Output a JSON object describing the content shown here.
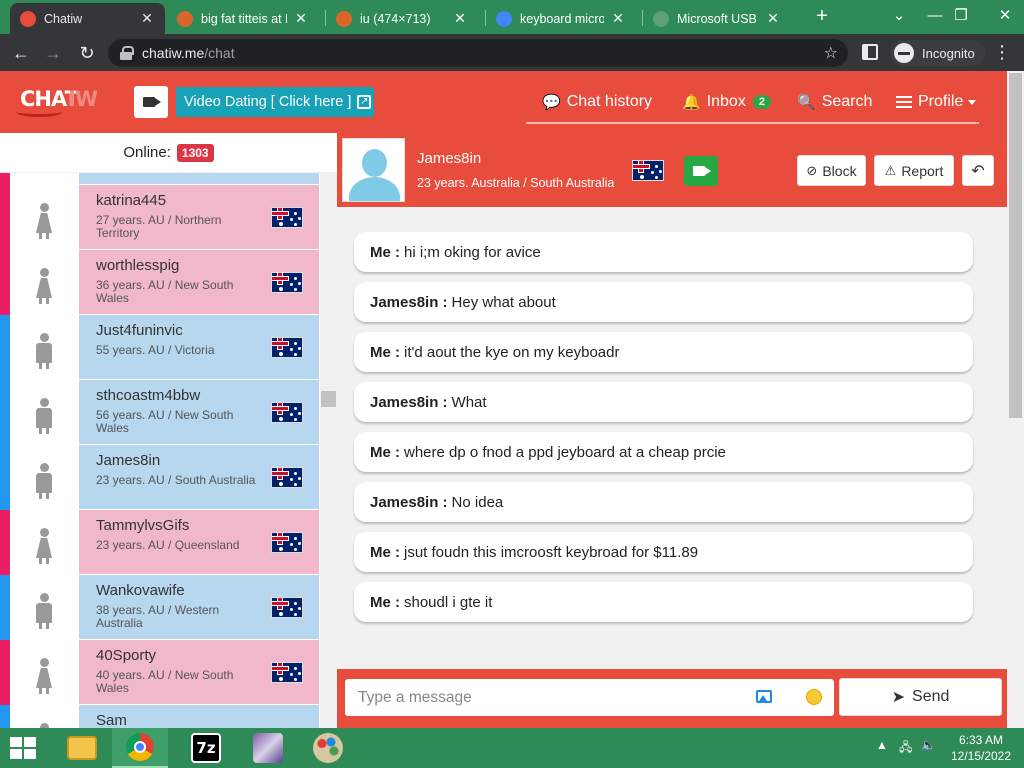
{
  "browser": {
    "tabs": [
      {
        "title": "Chatiw",
        "favicon_color": "#e84c3d",
        "active": true
      },
      {
        "title": "big fat titteis at D",
        "favicon_color": "#d9652b",
        "active": false
      },
      {
        "title": "iu (474×713)",
        "favicon_color": "#d9652b",
        "active": false
      },
      {
        "title": "keyboard microsc",
        "favicon_color": "#4285f4",
        "active": false
      },
      {
        "title": "Microsoft USB W",
        "favicon_color": "#5f9f7a",
        "active": false
      }
    ],
    "url_host": "chatiw.me",
    "url_path": "/chat",
    "profile_label": "Incognito"
  },
  "site": {
    "logo_text_a": "CHAT",
    "logo_text_b": "IW",
    "dating_label": "Video Dating [ Click here ]",
    "nav": {
      "chat_history": "Chat history",
      "inbox": "Inbox",
      "inbox_count": "2",
      "search": "Search",
      "profile": "Profile"
    },
    "accent_color": "#e84c3d"
  },
  "sidebar": {
    "online_label": "Online:",
    "online_count": "1303",
    "users": [
      {
        "name": "katrina445",
        "meta": "27 years. AU / Northern Territory",
        "gender": "female"
      },
      {
        "name": "worthlesspig",
        "meta": "36 years. AU / New South Wales",
        "gender": "female"
      },
      {
        "name": "Just4funinvic",
        "meta": "55 years. AU / Victoria",
        "gender": "male"
      },
      {
        "name": "sthcoastm4bbw",
        "meta": "56 years. AU / New South Wales",
        "gender": "male"
      },
      {
        "name": "James8in",
        "meta": "23 years. AU / South Australia",
        "gender": "male"
      },
      {
        "name": "TammylvsGifs",
        "meta": "23 years. AU / Queensland",
        "gender": "female"
      },
      {
        "name": "Wankovawife",
        "meta": "38 years. AU / Western Australia",
        "gender": "male"
      },
      {
        "name": "40Sporty",
        "meta": "40 years. AU / New South Wales",
        "gender": "female"
      },
      {
        "name": "Sam",
        "meta": "",
        "gender": "male"
      }
    ],
    "gender_colors": {
      "female": {
        "stripe": "#e91e63",
        "card": "#f1b8cb"
      },
      "male": {
        "stripe": "#2196f3",
        "card": "#b6d7ee"
      }
    }
  },
  "chat": {
    "peer_name": "James8in",
    "peer_meta": "23 years. Australia / South Australia",
    "block_label": "Block",
    "report_label": "Report",
    "messages": [
      {
        "who": "Me :",
        "text": "hi i;m oking for avice"
      },
      {
        "who": "James8in :",
        "text": "Hey what about"
      },
      {
        "who": "Me :",
        "text": "it'd aout the kye on my keyboadr"
      },
      {
        "who": "James8in :",
        "text": "What"
      },
      {
        "who": "Me :",
        "text": "where dp o fnod a ppd jeyboard at a cheap prcie"
      },
      {
        "who": "James8in :",
        "text": "No idea"
      },
      {
        "who": "Me :",
        "text": "jsut foudn this imcroosft keybroad for $11.89"
      },
      {
        "who": "Me :",
        "text": "shoudl i gte it"
      }
    ],
    "input_placeholder": "Type a message",
    "send_label": "Send"
  },
  "taskbar": {
    "time": "6:33 AM",
    "date": "12/15/2022"
  }
}
